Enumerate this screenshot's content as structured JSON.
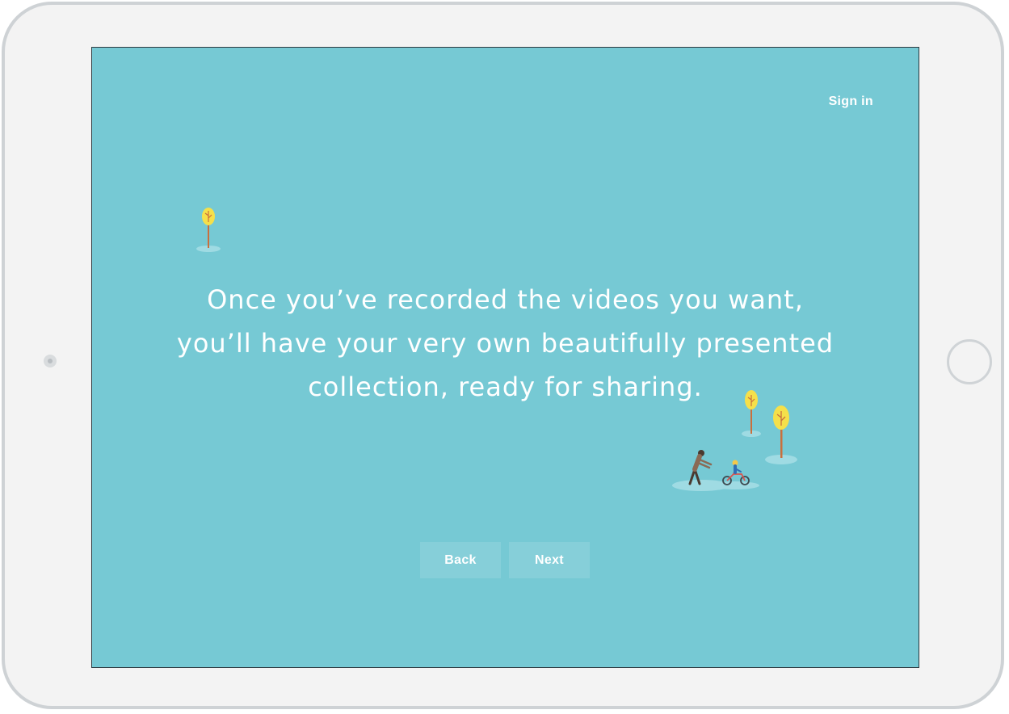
{
  "header": {
    "sign_in_label": "Sign in"
  },
  "main": {
    "message_lines": [
      "Once you’ve recorded the videos you want,",
      "you’ll have your very own beautifully presented",
      "collection, ready for sharing."
    ]
  },
  "navigation": {
    "back_label": "Back",
    "next_label": "Next"
  },
  "colors": {
    "screen_background": "#76c9d4",
    "tree_foliage": "#f5e04a",
    "tree_trunk": "#c96f3d",
    "ground_puddle": "#9fdbe3"
  }
}
